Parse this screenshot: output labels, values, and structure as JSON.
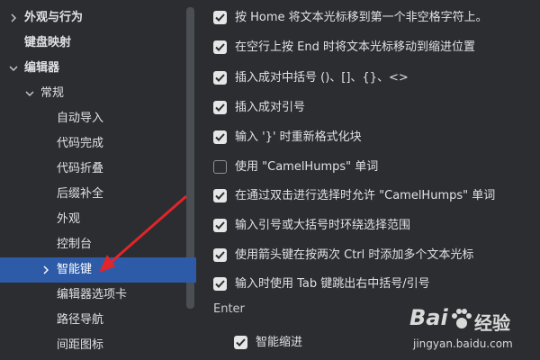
{
  "sidebar": {
    "items": [
      {
        "label": "外观与行为",
        "chevron": "right"
      },
      {
        "label": "键盘映射"
      },
      {
        "label": "编辑器",
        "chevron": "down"
      },
      {
        "label": "常规",
        "chevron": "down"
      },
      {
        "label": "自动导入"
      },
      {
        "label": "代码完成"
      },
      {
        "label": "代码折叠"
      },
      {
        "label": "后缀补全"
      },
      {
        "label": "外观"
      },
      {
        "label": "控制台"
      },
      {
        "label": "智能键",
        "chevron": "right",
        "selected": true
      },
      {
        "label": "编辑器选项卡"
      },
      {
        "label": "路径导航"
      },
      {
        "label": "间距图标"
      }
    ]
  },
  "options": [
    {
      "label": "按 Home 将文本光标移到第一个非空格字符上。",
      "checked": true
    },
    {
      "label": "在空行上按 End 时将文本光标移动到缩进位置",
      "checked": true
    },
    {
      "label": "插入成对中括号 ()、[]、{}、<>",
      "checked": true
    },
    {
      "label": "插入成对引号",
      "checked": true
    },
    {
      "label": "输入 '}' 时重新格式化块",
      "checked": true
    },
    {
      "label": "使用 \"CamelHumps\" 单词",
      "checked": false
    },
    {
      "label": "在通过双击进行选择时允许 \"CamelHumps\" 单词",
      "checked": true
    },
    {
      "label": "输入引号或大括号时环绕选择范围",
      "checked": true
    },
    {
      "label": "使用箭头键在按两次 Ctrl 时添加多个文本光标",
      "checked": true
    },
    {
      "label": "输入时使用 Tab 键跳出右中括号/引号",
      "checked": true
    }
  ],
  "enter_section": {
    "title": "Enter",
    "items": [
      {
        "label": "智能缩进",
        "checked": true
      }
    ]
  },
  "watermark": {
    "logo": "Bai",
    "title": "经验",
    "url": "jingyan.baidu.com"
  },
  "colors": {
    "background": "#2b2d30",
    "selection": "#2e5ba8",
    "text": "#dfe1e5",
    "arrow": "#e0252b"
  }
}
